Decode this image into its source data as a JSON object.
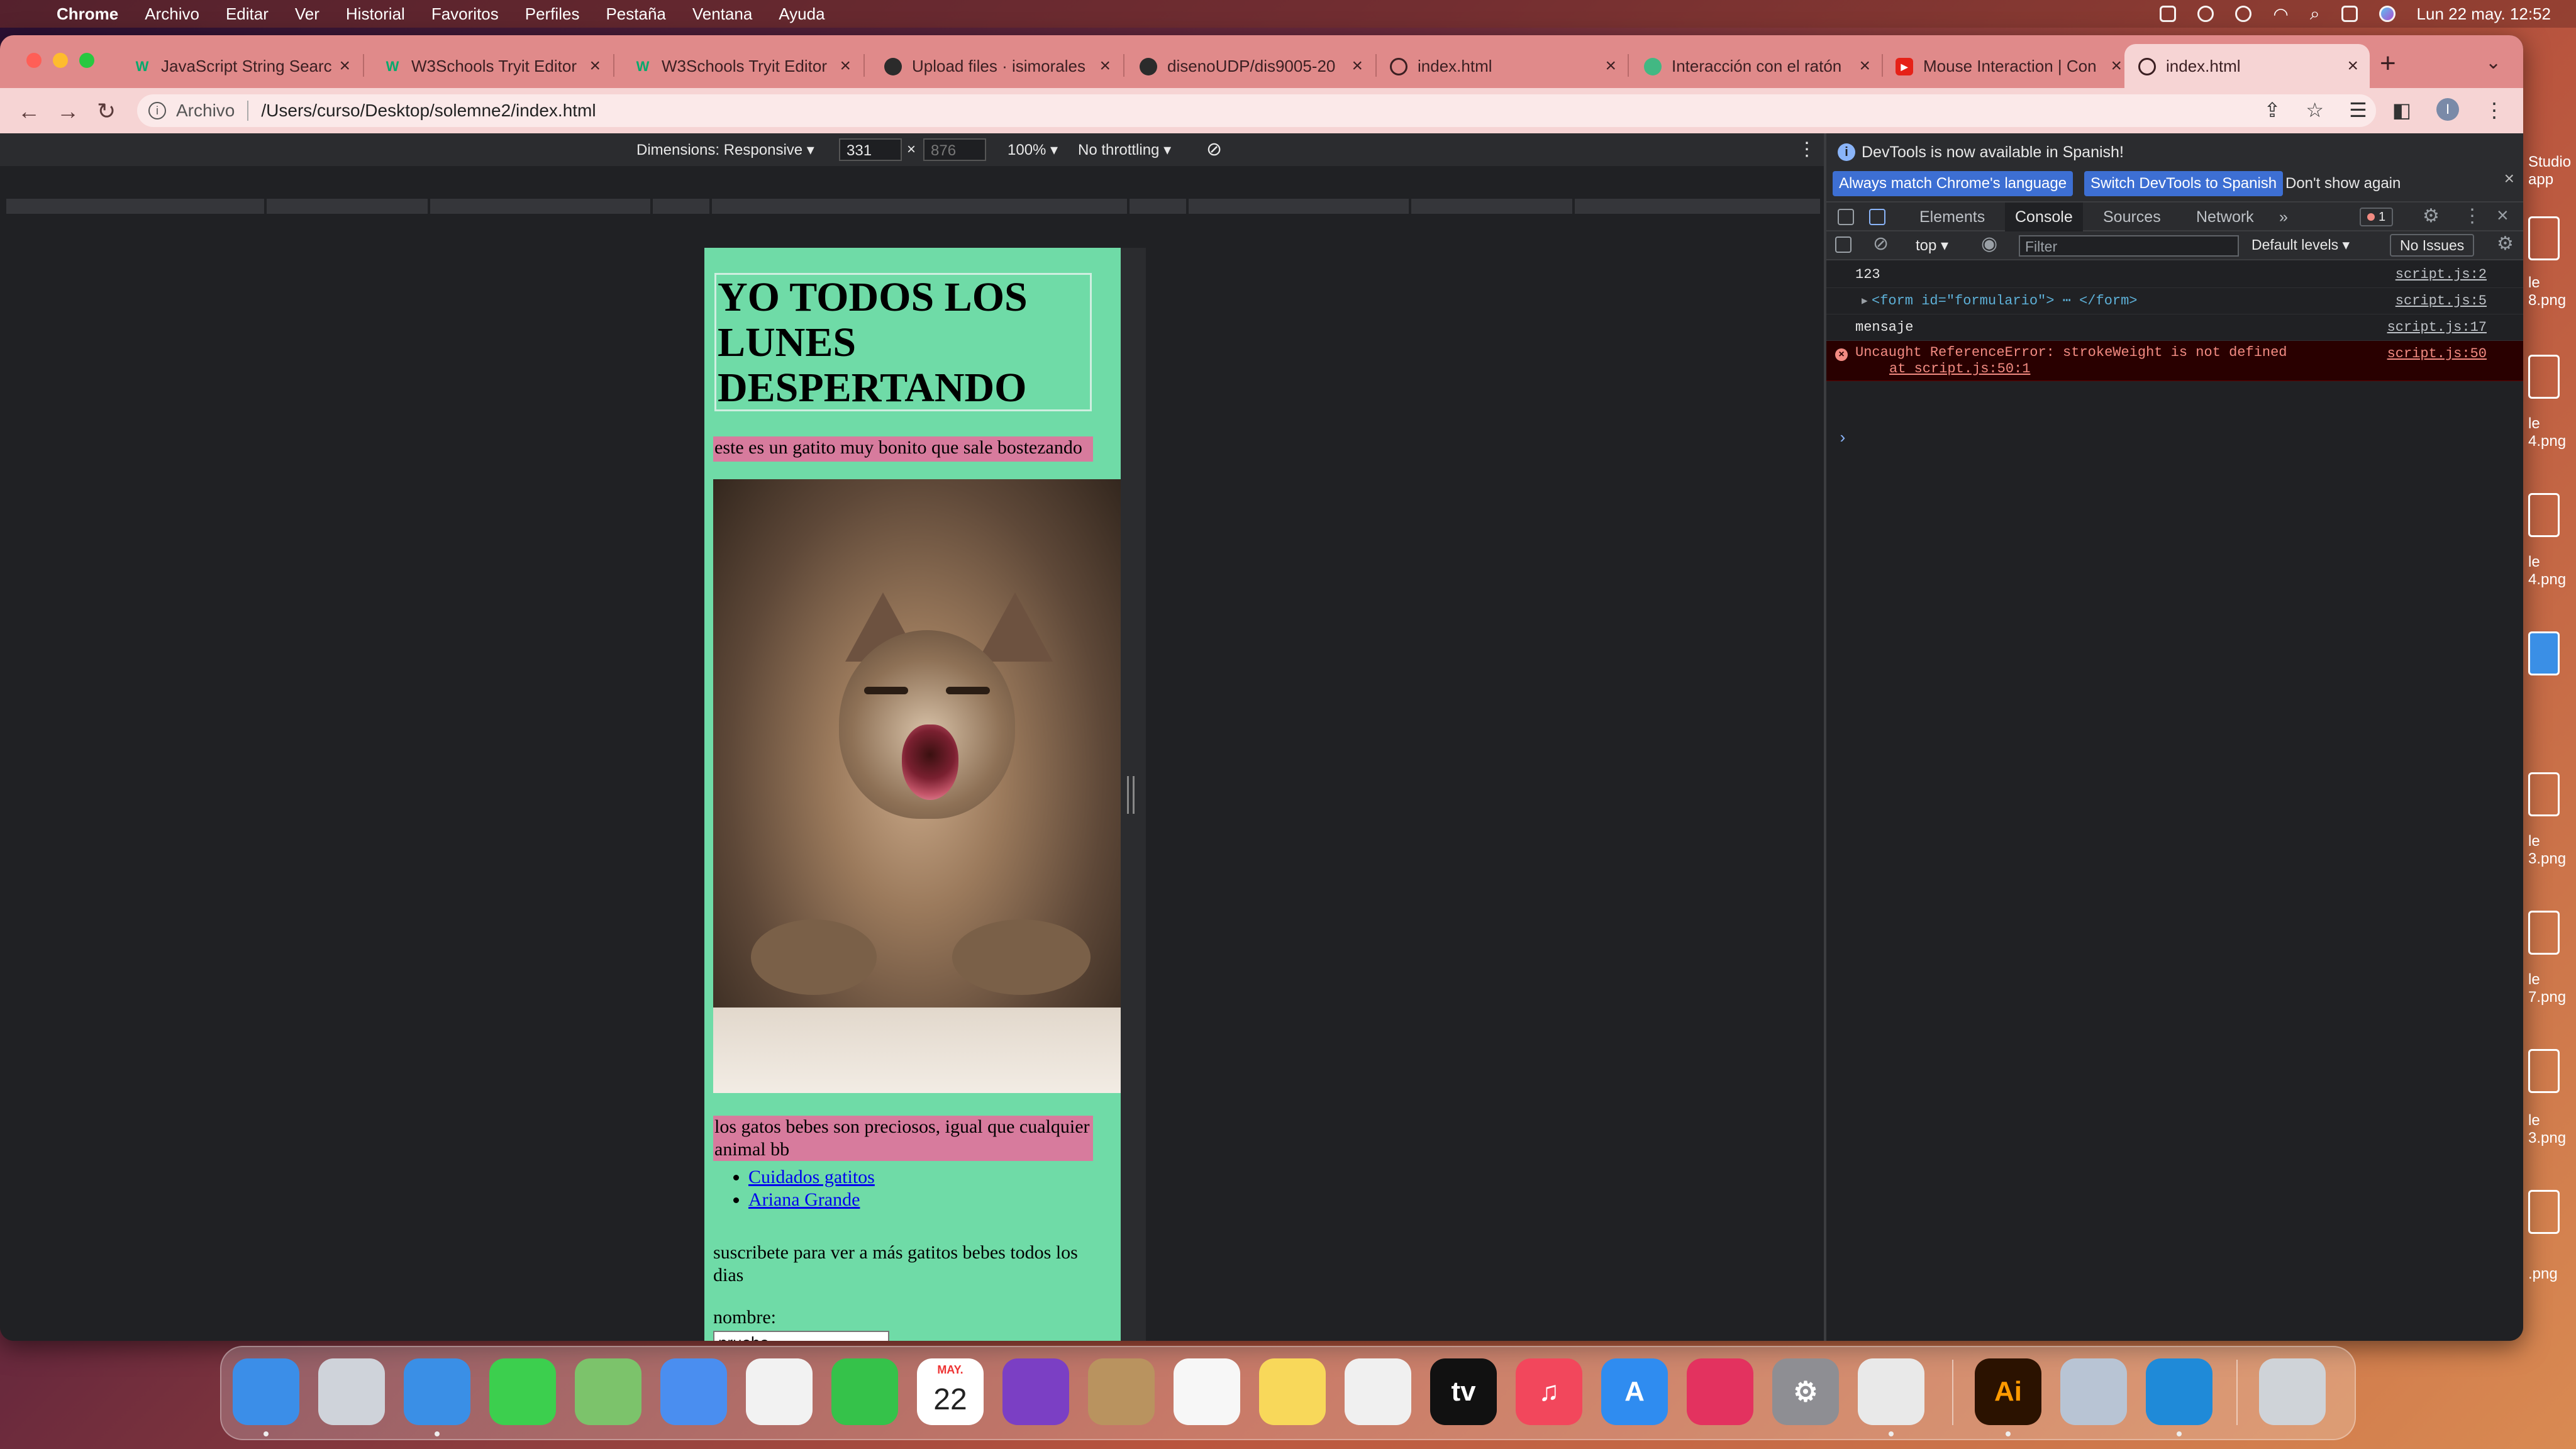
{
  "menubar": {
    "app": "Chrome",
    "items": [
      "Archivo",
      "Editar",
      "Ver",
      "Historial",
      "Favoritos",
      "Perfiles",
      "Pestaña",
      "Ventana",
      "Ayuda"
    ],
    "clock": "Lun 22 may.  12:52"
  },
  "tabs": [
    {
      "label": "JavaScript String Searc",
      "icon": "w3schools-icon"
    },
    {
      "label": "W3Schools Tryit Editor",
      "icon": "w3schools-icon"
    },
    {
      "label": "W3Schools Tryit Editor",
      "icon": "w3schools-icon"
    },
    {
      "label": "Upload files · isimorales",
      "icon": "github-icon"
    },
    {
      "label": "disenoUDP/dis9005-20",
      "icon": "github-icon"
    },
    {
      "label": "index.html",
      "icon": "globe-icon"
    },
    {
      "label": "Interacción con el ratón",
      "icon": "vue-icon"
    },
    {
      "label": "Mouse Interaction | Con",
      "icon": "youtube-icon"
    },
    {
      "label": "index.html",
      "icon": "globe-icon"
    }
  ],
  "address": {
    "scheme": "Archivo",
    "url": "/Users/curso/Desktop/solemne2/index.html"
  },
  "device": {
    "dimensions": "Dimensions: Responsive ▾",
    "width": "331",
    "height": "876",
    "zoom": "100% ▾",
    "throttling": "No throttling ▾"
  },
  "page": {
    "heading": "YO TODOS LOS LUNES DESPERTANDO",
    "caption1": "este es un gatito muy bonito que sale bostezando",
    "caption2": "los gatos bebes son preciosos, igual que cualquier animal bb",
    "links": [
      "Cuidados gatitos",
      "Ariana Grande"
    ],
    "subscribe": "suscribete para ver a más gatitos bebes todos los dias",
    "name_label": "nombre:",
    "name_value": "prueba"
  },
  "devtools": {
    "banner": "DevTools is now available in Spanish!",
    "btn_match": "Always match Chrome's language",
    "btn_switch": "Switch DevTools to Spanish",
    "btn_dont": "Don't show again",
    "tabs": [
      "Elements",
      "Console",
      "Sources",
      "Network"
    ],
    "more": "»",
    "error_count": "1",
    "context": "top ▾",
    "filter_placeholder": "Filter",
    "levels": "Default levels ▾",
    "issues": "No Issues",
    "logs": [
      {
        "text": "123",
        "source": "script.js:2"
      },
      {
        "text": "<form id=\"formulario\"> ⋯ </form>",
        "source": "script.js:5"
      },
      {
        "text": "mensaje",
        "source": "script.js:17"
      }
    ],
    "error": {
      "line1": "Uncaught ReferenceError: strokeWeight is not defined",
      "line2": "at script.js:50:1",
      "source": "script.js:50"
    }
  },
  "desktop_labels": [
    "Studio",
    "app",
    "le",
    "8.png",
    "le",
    "4.png",
    "le",
    "4.png",
    "le",
    "3.png",
    "le",
    "7.png",
    "le",
    "3.png",
    ".png"
  ],
  "dock": [
    {
      "name": "finder-icon",
      "color": "#3b8ee8",
      "glyph": ""
    },
    {
      "name": "launchpad-icon",
      "color": "#cfd3da",
      "glyph": ""
    },
    {
      "name": "safari-icon",
      "color": "#3a8fe6",
      "glyph": ""
    },
    {
      "name": "messages-icon",
      "color": "#3ccf4e",
      "glyph": ""
    },
    {
      "name": "maps-icon",
      "color": "#7cc36b",
      "glyph": ""
    },
    {
      "name": "mail-icon",
      "color": "#4a8ef0",
      "glyph": ""
    },
    {
      "name": "photos-icon",
      "color": "#f2f2f2",
      "glyph": ""
    },
    {
      "name": "facetime-icon",
      "color": "#35c24a",
      "glyph": ""
    },
    {
      "name": "calendar-icon",
      "color": "#ffffff",
      "glyph": "22",
      "month": "MAY."
    },
    {
      "name": "github-desktop-icon",
      "color": "#7b3fc4",
      "glyph": ""
    },
    {
      "name": "contacts-icon",
      "color": "#b9935f",
      "glyph": ""
    },
    {
      "name": "reminders-icon",
      "color": "#f7f7f7",
      "glyph": ""
    },
    {
      "name": "notes-icon",
      "color": "#f8d85a",
      "glyph": ""
    },
    {
      "name": "freeform-icon",
      "color": "#f0f0f0",
      "glyph": ""
    },
    {
      "name": "apple-tv-icon",
      "color": "#111111",
      "glyph": "tv"
    },
    {
      "name": "music-icon",
      "color": "#f2475c",
      "glyph": "♫"
    },
    {
      "name": "app-store-icon",
      "color": "#2f8cf0",
      "glyph": "A"
    },
    {
      "name": "creative-cloud-icon",
      "color": "#e3325f",
      "glyph": ""
    },
    {
      "name": "system-settings-icon",
      "color": "#8e8e93",
      "glyph": "⚙"
    },
    {
      "name": "chrome-icon",
      "color": "#e9e9e9",
      "glyph": ""
    },
    {
      "name": "illustrator-icon",
      "color": "#2b1200",
      "glyph": "Ai"
    },
    {
      "name": "preview-icon",
      "color": "#b8c4d4",
      "glyph": ""
    },
    {
      "name": "vscode-icon",
      "color": "#1f8ad8",
      "glyph": ""
    },
    {
      "name": "trash-icon",
      "color": "#cfd3d8",
      "glyph": ""
    }
  ]
}
